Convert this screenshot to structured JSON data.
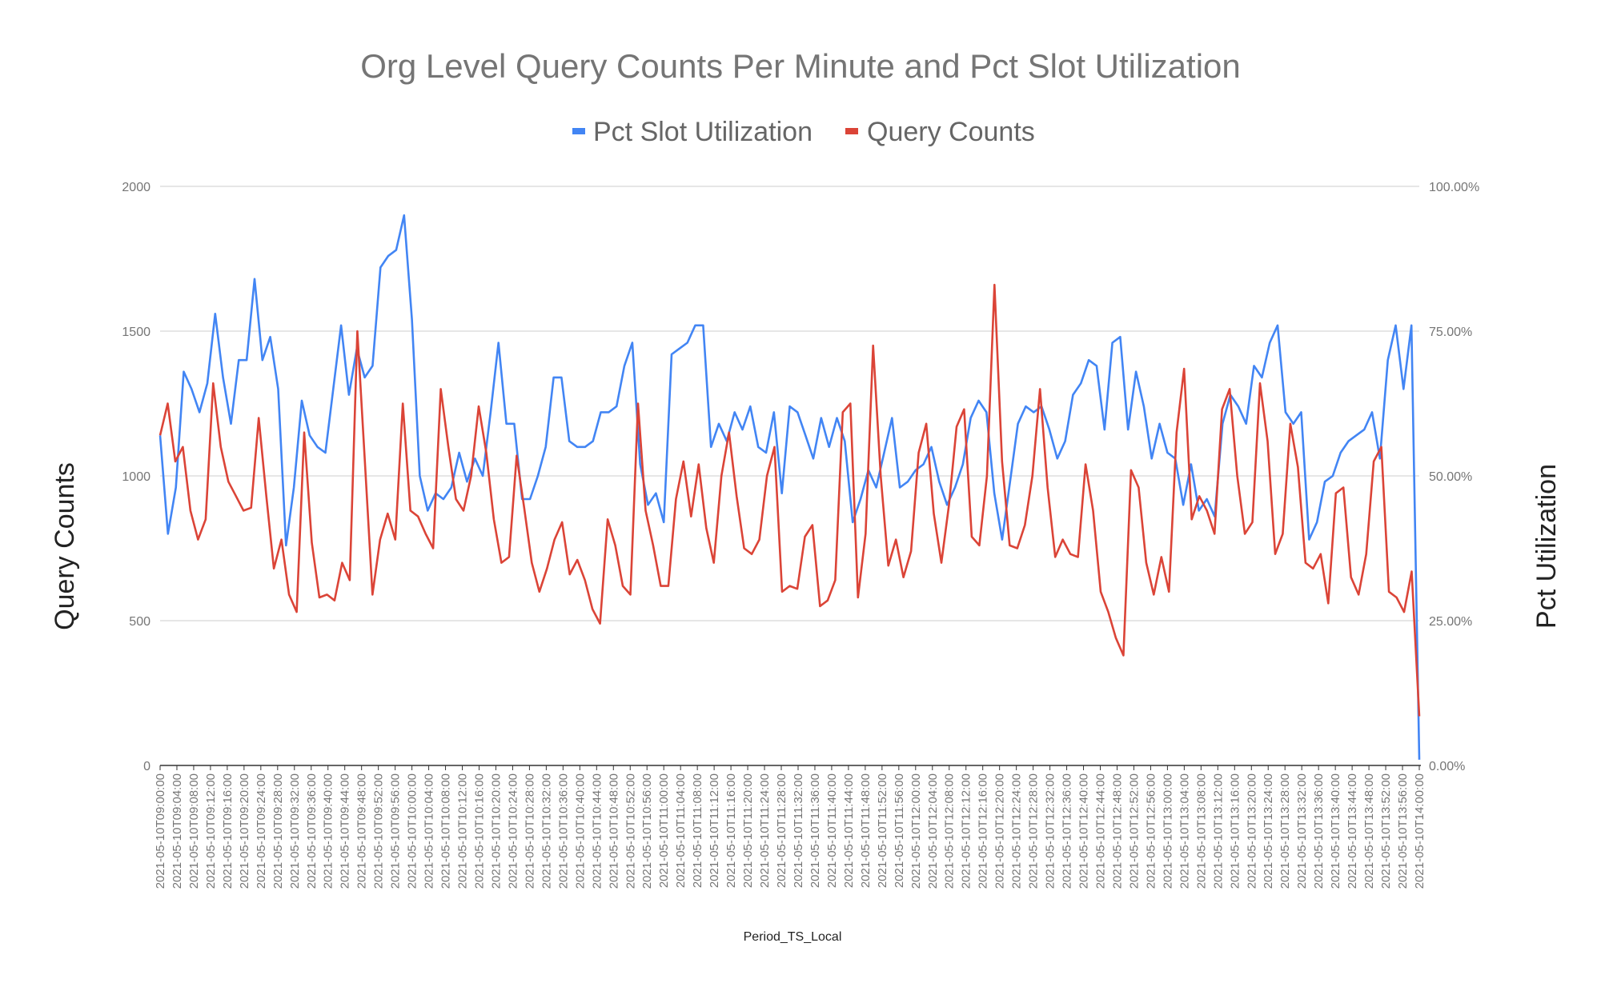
{
  "chart_data": {
    "type": "line",
    "title": "Org Level Query Counts Per Minute and Pct Slot Utilization",
    "xlabel": "Period_TS_Local",
    "ylabel": "Query Counts",
    "y2label": "Pct Utilization",
    "ylim": [
      0,
      2000
    ],
    "y2lim": [
      0,
      1
    ],
    "yticks": [
      "0",
      "500",
      "1000",
      "1500",
      "2000"
    ],
    "y2ticks": [
      "0.00%",
      "25.00%",
      "50.00%",
      "75.00%",
      "100.00%"
    ],
    "grid": true,
    "legend_position": "top",
    "x_start": "2021-05-10T09:00:00",
    "x_end": "2021-05-10T14:00:00",
    "x_step_minutes": 2,
    "x_tick_labels": [
      "2021-05-10T09:00:00",
      "2021-05-10T09:04:00",
      "2021-05-10T09:08:00",
      "2021-05-10T09:12:00",
      "2021-05-10T09:16:00",
      "2021-05-10T09:20:00",
      "2021-05-10T09:24:00",
      "2021-05-10T09:28:00",
      "2021-05-10T09:32:00",
      "2021-05-10T09:36:00",
      "2021-05-10T09:40:00",
      "2021-05-10T09:44:00",
      "2021-05-10T09:48:00",
      "2021-05-10T09:52:00",
      "2021-05-10T09:56:00",
      "2021-05-10T10:00:00",
      "2021-05-10T10:04:00",
      "2021-05-10T10:08:00",
      "2021-05-10T10:12:00",
      "2021-05-10T10:16:00",
      "2021-05-10T10:20:00",
      "2021-05-10T10:24:00",
      "2021-05-10T10:28:00",
      "2021-05-10T10:32:00",
      "2021-05-10T10:36:00",
      "2021-05-10T10:40:00",
      "2021-05-10T10:44:00",
      "2021-05-10T10:48:00",
      "2021-05-10T10:52:00",
      "2021-05-10T10:56:00",
      "2021-05-10T11:00:00",
      "2021-05-10T11:04:00",
      "2021-05-10T11:08:00",
      "2021-05-10T11:12:00",
      "2021-05-10T11:16:00",
      "2021-05-10T11:20:00",
      "2021-05-10T11:24:00",
      "2021-05-10T11:28:00",
      "2021-05-10T11:32:00",
      "2021-05-10T11:36:00",
      "2021-05-10T11:40:00",
      "2021-05-10T11:44:00",
      "2021-05-10T11:48:00",
      "2021-05-10T11:52:00",
      "2021-05-10T11:56:00",
      "2021-05-10T12:00:00",
      "2021-05-10T12:04:00",
      "2021-05-10T12:08:00",
      "2021-05-10T12:12:00",
      "2021-05-10T12:16:00",
      "2021-05-10T12:20:00",
      "2021-05-10T12:24:00",
      "2021-05-10T12:28:00",
      "2021-05-10T12:32:00",
      "2021-05-10T12:36:00",
      "2021-05-10T12:40:00",
      "2021-05-10T12:44:00",
      "2021-05-10T12:48:00",
      "2021-05-10T12:52:00",
      "2021-05-10T12:56:00",
      "2021-05-10T13:00:00",
      "2021-05-10T13:04:00",
      "2021-05-10T13:08:00",
      "2021-05-10T13:12:00",
      "2021-05-10T13:16:00",
      "2021-05-10T13:20:00",
      "2021-05-10T13:24:00",
      "2021-05-10T13:28:00",
      "2021-05-10T13:32:00",
      "2021-05-10T13:36:00",
      "2021-05-10T13:40:00",
      "2021-05-10T13:44:00",
      "2021-05-10T13:48:00",
      "2021-05-10T13:52:00",
      "2021-05-10T13:56:00",
      "2021-05-10T14:00:00"
    ],
    "series": [
      {
        "name": "Pct Slot Utilization",
        "axis": "right",
        "color": "#4285f4",
        "values": [
          0.57,
          0.4,
          0.48,
          0.68,
          0.65,
          0.61,
          0.66,
          0.78,
          0.67,
          0.59,
          0.7,
          0.7,
          0.84,
          0.7,
          0.74,
          0.65,
          0.38,
          0.48,
          0.63,
          0.57,
          0.55,
          0.54,
          0.65,
          0.76,
          0.64,
          0.72,
          0.67,
          0.69,
          0.86,
          0.88,
          0.89,
          0.95,
          0.77,
          0.5,
          0.44,
          0.47,
          0.46,
          0.48,
          0.54,
          0.49,
          0.53,
          0.5,
          0.61,
          0.73,
          0.59,
          0.59,
          0.46,
          0.46,
          0.5,
          0.55,
          0.67,
          0.67,
          0.56,
          0.55,
          0.55,
          0.56,
          0.61,
          0.61,
          0.62,
          0.69,
          0.73,
          0.52,
          0.45,
          0.47,
          0.42,
          0.71,
          0.72,
          0.73,
          0.76,
          0.76,
          0.55,
          0.59,
          0.56,
          0.61,
          0.58,
          0.62,
          0.55,
          0.54,
          0.61,
          0.47,
          0.62,
          0.61,
          0.57,
          0.53,
          0.6,
          0.55,
          0.6,
          0.56,
          0.42,
          0.46,
          0.51,
          0.48,
          0.54,
          0.6,
          0.48,
          0.49,
          0.51,
          0.52,
          0.55,
          0.49,
          0.45,
          0.48,
          0.52,
          0.6,
          0.63,
          0.61,
          0.47,
          0.39,
          0.49,
          0.59,
          0.62,
          0.61,
          0.62,
          0.58,
          0.53,
          0.56,
          0.64,
          0.66,
          0.7,
          0.69,
          0.58,
          0.73,
          0.74,
          0.58,
          0.68,
          0.62,
          0.53,
          0.59,
          0.54,
          0.53,
          0.45,
          0.52,
          0.44,
          0.46,
          0.43,
          0.59,
          0.64,
          0.62,
          0.59,
          0.69,
          0.67,
          0.73,
          0.76,
          0.61,
          0.59,
          0.61,
          0.39,
          0.42,
          0.49,
          0.5,
          0.54,
          0.56,
          0.57,
          0.58,
          0.61,
          0.53,
          0.7,
          0.76,
          0.65,
          0.76,
          0.01
        ]
      },
      {
        "name": "Query Counts",
        "axis": "left",
        "color": "#db4437",
        "values": [
          1140,
          1250,
          1050,
          1100,
          880,
          780,
          850,
          1320,
          1100,
          980,
          930,
          880,
          890,
          1200,
          930,
          680,
          780,
          590,
          530,
          1150,
          770,
          580,
          590,
          570,
          700,
          640,
          1500,
          1050,
          590,
          780,
          870,
          780,
          1250,
          880,
          860,
          800,
          750,
          1300,
          1100,
          920,
          880,
          1000,
          1240,
          1080,
          850,
          700,
          720,
          1070,
          890,
          700,
          600,
          680,
          780,
          840,
          660,
          710,
          640,
          540,
          490,
          850,
          760,
          620,
          590,
          1250,
          880,
          760,
          620,
          620,
          920,
          1050,
          860,
          1040,
          820,
          700,
          1000,
          1150,
          930,
          750,
          730,
          780,
          1000,
          1100,
          600,
          620,
          610,
          790,
          830,
          550,
          570,
          640,
          1220,
          1250,
          580,
          800,
          1450,
          1000,
          690,
          780,
          650,
          740,
          1080,
          1180,
          870,
          700,
          900,
          1170,
          1230,
          790,
          760,
          1000,
          1660,
          1050,
          760,
          750,
          830,
          1000,
          1300,
          960,
          720,
          780,
          730,
          720,
          1040,
          880,
          600,
          530,
          440,
          380,
          1020,
          960,
          700,
          590,
          720,
          600,
          1150,
          1370,
          850,
          930,
          880,
          800,
          1230,
          1300,
          1000,
          800,
          840,
          1320,
          1120,
          730,
          800,
          1180,
          1030,
          700,
          680,
          730,
          560,
          940,
          960,
          650,
          590,
          730,
          1050,
          1100,
          600,
          580,
          530,
          670,
          170
        ]
      }
    ]
  }
}
